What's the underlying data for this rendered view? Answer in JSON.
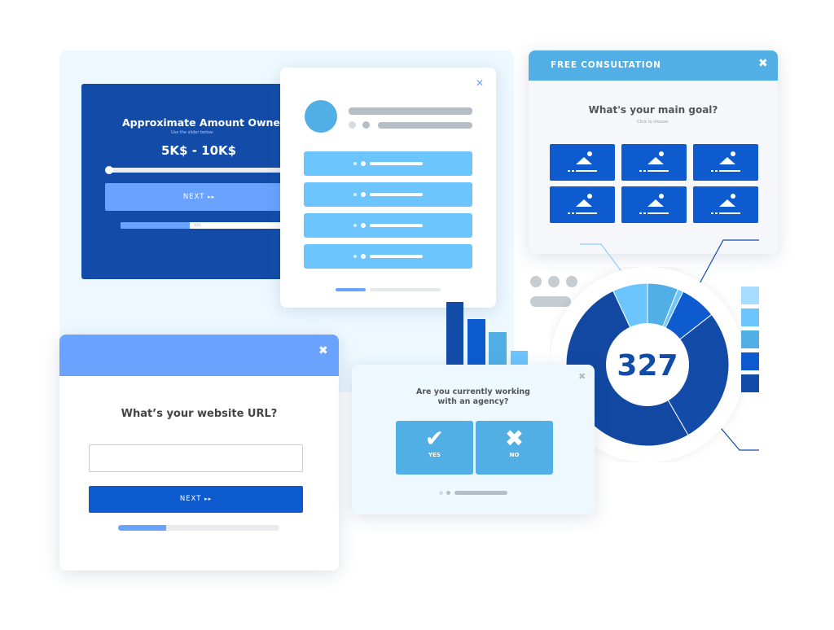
{
  "amount_form": {
    "title": "Approximate Amount Owned",
    "subtitle": "Use the slider below:",
    "value": "5K$ - 10K$",
    "slider_fraction": 0,
    "next_label": "NEXT",
    "next_icon": "double-chevron-right-icon",
    "progress_label": "40%",
    "progress": 0.4
  },
  "profile_form": {
    "close_icon": "close-icon",
    "option_count": 4
  },
  "consultation": {
    "header": "FREE CONSULTATION",
    "close_icon": "close-icon",
    "question": "What's your main goal?",
    "hint": "Click to choose:",
    "option_icon": "image-icon",
    "option_count": 6
  },
  "donut": {
    "value": "327"
  },
  "url_form": {
    "question": "What’s your website URL?",
    "input_value": "",
    "next_label": "NEXT",
    "progress": 0.3
  },
  "agency_form": {
    "question_line1": "Are you currently working",
    "question_line2": "with an agency?",
    "yes_label": "YES",
    "no_label": "NO"
  },
  "colors": {
    "dark_blue": "#134ca8",
    "blue": "#0d5bce",
    "sky": "#52afe6",
    "light": "#6cc5ff",
    "periwinkle": "#6aa3ff"
  }
}
